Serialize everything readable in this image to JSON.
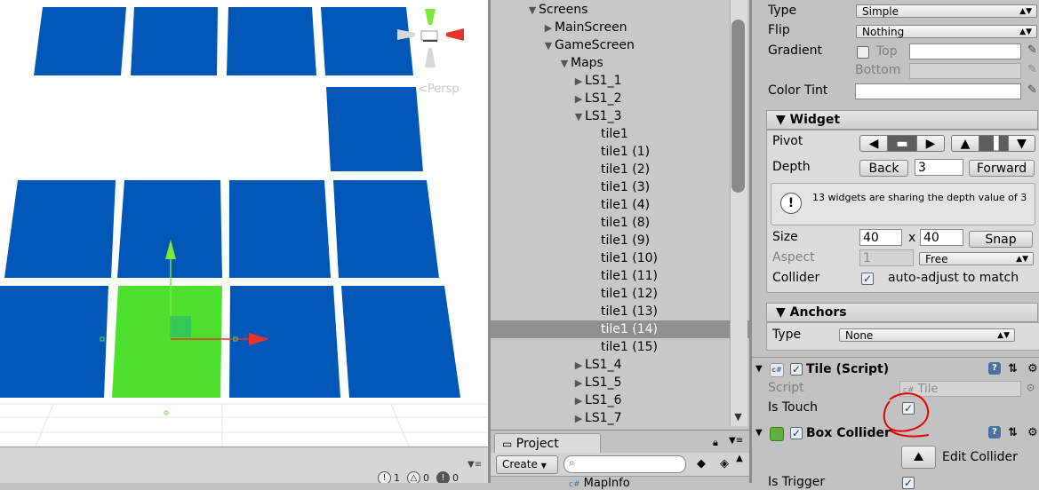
{
  "scene": {
    "persp_label": "Persp",
    "stats": [
      {
        "icon": "info-icon",
        "count": "1"
      },
      {
        "icon": "warning-icon",
        "count": "0"
      },
      {
        "icon": "error-icon",
        "count": "0"
      }
    ],
    "colors": {
      "tile": "#0057b8",
      "selected_tile": "#4ee02f",
      "gizmo_x": "#e8332a",
      "gizmo_y": "#7ee83a"
    }
  },
  "hierarchy": {
    "rows": [
      {
        "label": "Screens",
        "arrow": "▼"
      },
      {
        "label": "MainScreen",
        "arrow": "▶"
      },
      {
        "label": "GameScreen",
        "arrow": "▼"
      },
      {
        "label": "Maps",
        "arrow": "▼"
      },
      {
        "label": "LS1_1",
        "arrow": "▶"
      },
      {
        "label": "LS1_2",
        "arrow": "▶"
      },
      {
        "label": "LS1_3",
        "arrow": "▼"
      },
      {
        "label": "tile1",
        "arrow": ""
      },
      {
        "label": "tile1 (1)",
        "arrow": ""
      },
      {
        "label": "tile1 (2)",
        "arrow": ""
      },
      {
        "label": "tile1 (3)",
        "arrow": ""
      },
      {
        "label": "tile1 (4)",
        "arrow": ""
      },
      {
        "label": "tile1 (8)",
        "arrow": ""
      },
      {
        "label": "tile1 (9)",
        "arrow": ""
      },
      {
        "label": "tile1 (10)",
        "arrow": ""
      },
      {
        "label": "tile1 (11)",
        "arrow": ""
      },
      {
        "label": "tile1 (12)",
        "arrow": ""
      },
      {
        "label": "tile1 (13)",
        "arrow": ""
      },
      {
        "label": "tile1 (14)",
        "arrow": ""
      },
      {
        "label": "tile1 (15)",
        "arrow": ""
      },
      {
        "label": "LS1_4",
        "arrow": "▶"
      },
      {
        "label": "LS1_5",
        "arrow": "▶"
      },
      {
        "label": "LS1_6",
        "arrow": "▶"
      },
      {
        "label": "LS1_7",
        "arrow": "▶"
      }
    ],
    "selected": "tile1 (14)"
  },
  "project": {
    "tab_label": "Project",
    "create_label": "Create",
    "file_label": "MapInfo"
  },
  "inspector": {
    "type_label": "Type",
    "type_value": "Simple",
    "flip_label": "Flip",
    "flip_value": "Nothing",
    "gradient_label": "Gradient",
    "top_label": "Top",
    "bottom_label": "Bottom",
    "color_tint_label": "Color Tint",
    "widget_header": "Widget",
    "pivot_label": "Pivot",
    "depth_label": "Depth",
    "back_label": "Back",
    "depth_value": "3",
    "forward_label": "Forward",
    "depth_warning": "13 widgets are sharing the depth value of 3",
    "size_label": "Size",
    "size_w": "40",
    "size_x": "x",
    "size_h": "40",
    "snap_label": "Snap",
    "aspect_label": "Aspect",
    "aspect_value": "1",
    "aspect_mode": "Free",
    "collider_label": "Collider",
    "collider_text": "auto-adjust to match",
    "anchors_header": "Anchors",
    "anchors_type_label": "Type",
    "anchors_type_value": "None",
    "tile_script_header": "Tile (Script)",
    "script_label": "Script",
    "script_value": "Tile",
    "is_touch_label": "Is Touch",
    "box_collider_header": "Box Collider",
    "edit_collider_label": "Edit Collider",
    "is_trigger_label": "Is Trigger"
  }
}
